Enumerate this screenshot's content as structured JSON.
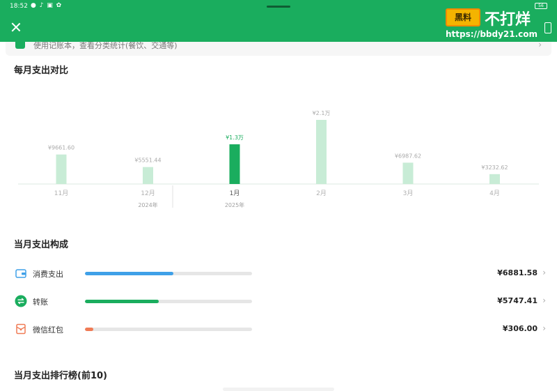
{
  "status_bar": {
    "time": "18:52",
    "icons": "● ♪ ▣ ✿",
    "battery": "56"
  },
  "watermark": {
    "logo_text": "黑料",
    "brand": "不打烊",
    "url": "https://bbdy21.com"
  },
  "tip": {
    "text": "使用记账本，查看分类统计(餐饮、交通等)"
  },
  "monthly_compare": {
    "title": "每月支出对比"
  },
  "chart_data": {
    "type": "bar",
    "categories": [
      "11月",
      "12月",
      "1月",
      "2月",
      "3月",
      "4月"
    ],
    "values": [
      9661.6,
      5551.44,
      13000,
      21000,
      6987.62,
      3232.62
    ],
    "data_labels": [
      "¥9661.60",
      "¥5551.44",
      "¥1.3万",
      "¥2.1万",
      "¥6987.62",
      "¥3232.62"
    ],
    "year_labels": [
      {
        "text": "2024年",
        "category_index": 1
      },
      {
        "text": "2025年",
        "category_index": 2
      }
    ],
    "highlight_index": 2,
    "colors": {
      "bar": "#c8ecd6",
      "highlight": "#1aad5e",
      "label": "#a9a9a9",
      "highlight_label": "#1aad5e"
    },
    "title": "",
    "xlabel": "",
    "ylabel": "",
    "ylim": [
      0,
      21000
    ],
    "grid": false,
    "legend": "none"
  },
  "composition": {
    "title": "当月支出构成",
    "items": [
      {
        "label": "消费支出",
        "amount": "¥6881.58",
        "fraction": 0.53,
        "color": "#3fa0e8",
        "icon": "wallet-icon"
      },
      {
        "label": "转账",
        "amount": "¥5747.41",
        "fraction": 0.44,
        "color": "#1aad5e",
        "icon": "transfer-icon"
      },
      {
        "label": "微信红包",
        "amount": "¥306.00",
        "fraction": 0.05,
        "color": "#f07b55",
        "icon": "red-packet-icon"
      }
    ]
  },
  "ranking": {
    "title": "当月支出排行榜(前10)"
  }
}
